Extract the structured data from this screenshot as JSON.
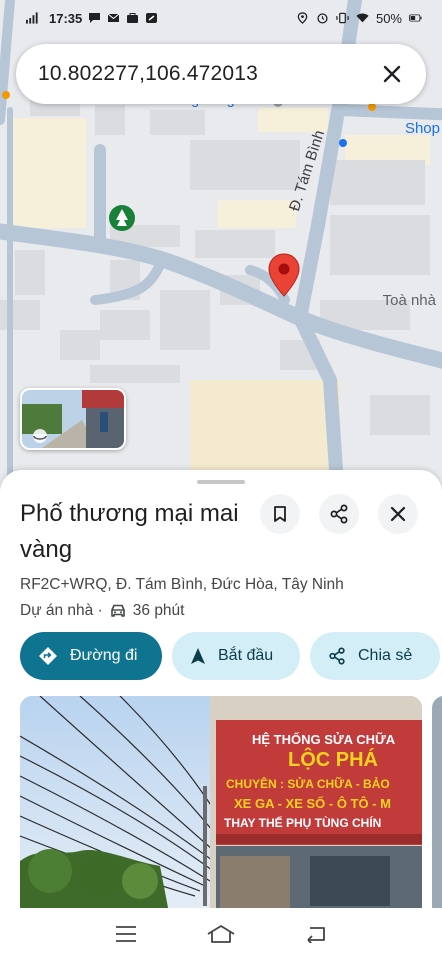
{
  "status_bar": {
    "time": "17:35",
    "battery": "50%"
  },
  "search": {
    "query": "10.802277,106.472013"
  },
  "map": {
    "labels": {
      "shop": "Shop",
      "toa": "Toà nhà",
      "street": "Đ. Tám Bình",
      "hoa": "Hoa Cong Vang"
    }
  },
  "place": {
    "title": "Phố thương mại mai vàng",
    "address": "RF2C+WRQ, Đ. Tám Bình, Đức Hòa, Tây Ninh",
    "category": "Dự án nhà ·",
    "drive_time": "36 phút"
  },
  "actions": {
    "directions": "Đường đi",
    "start": "Bắt đầu",
    "share": "Chia sẻ"
  },
  "photo_sign": {
    "line1": "HỆ THỐNG SỬA CHỮA",
    "line2": "LỘC PHÁ",
    "line3": "CHUYÊN : SỬA CHỮA - BẢO",
    "line4": "XE GA - XE SỐ - Ô TÔ - M",
    "line5": "THAY THẾ PHỤ TÙNG CHÍN"
  },
  "colors": {
    "primary": "#0e7490",
    "secondary_chip": "#d3eef6",
    "pin": "#ea4335"
  }
}
